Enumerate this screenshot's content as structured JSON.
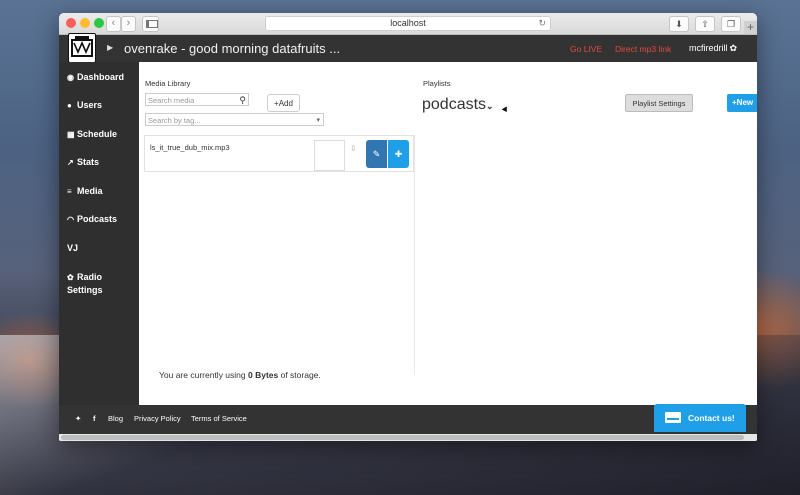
{
  "browser": {
    "url": "localhost",
    "back_glyph": "‹",
    "forward_glyph": "›",
    "reload_glyph": "↻",
    "download_glyph": "⬇",
    "share_glyph": "⇧",
    "tabs_glyph": "❐",
    "newtab_glyph": "+"
  },
  "header": {
    "play_glyph": "▶",
    "station_title": "ovenrake - good morning datafruits ...",
    "go_live": "Go LIVE",
    "direct_mp3": "Direct mp3 link",
    "username": "mcfiredrill",
    "user_gear_glyph": "✿"
  },
  "sidebar": {
    "items": [
      {
        "label": "Dashboard",
        "icon": "dashboard-icon",
        "glyph": "◉"
      },
      {
        "label": "Users",
        "icon": "users-icon",
        "glyph": "●"
      },
      {
        "label": "Schedule",
        "icon": "calendar-icon",
        "glyph": "▦"
      },
      {
        "label": "Stats",
        "icon": "stats-icon",
        "glyph": "↗"
      },
      {
        "label": "Media",
        "icon": "list-icon",
        "glyph": "≡"
      },
      {
        "label": "Podcasts",
        "icon": "rss-icon",
        "glyph": "◠"
      },
      {
        "label": "VJ",
        "icon": "",
        "glyph": ""
      },
      {
        "label": "Radio Settings",
        "label_line1": "Radio",
        "label_line2": "Settings",
        "icon": "gear-icon",
        "glyph": "✿"
      }
    ]
  },
  "media_library": {
    "title": "Media Library",
    "search_placeholder": "Search media",
    "search_glyph": "🔍",
    "add_label": "+Add",
    "tag_placeholder": "Search by tag...",
    "tag_chevron": "▾",
    "items": [
      {
        "filename": "ls_it_true_dub_mix.mp3",
        "download_glyph": "⇩",
        "edit_glyph": "✎",
        "add_glyph": "✚"
      }
    ]
  },
  "playlists": {
    "title": "Playlists",
    "selected": "podcasts",
    "chevron": "⌄",
    "settings_label": "Playlist Settings",
    "new_label": "+New"
  },
  "storage": {
    "prefix": "You are currently using ",
    "amount": "0 Bytes",
    "suffix": " of storage."
  },
  "footer": {
    "twitter_glyph": "🐦",
    "facebook_glyph": "f",
    "blog": "Blog",
    "privacy": "Privacy Policy",
    "terms": "Terms of Service",
    "contact": "Contact us!"
  },
  "colors": {
    "header_bg": "#333333",
    "sidebar_bg": "#2f2f2f",
    "accent_blue": "#1e9fe8",
    "edit_blue": "#3276b1",
    "live_red": "#e04a3a"
  }
}
